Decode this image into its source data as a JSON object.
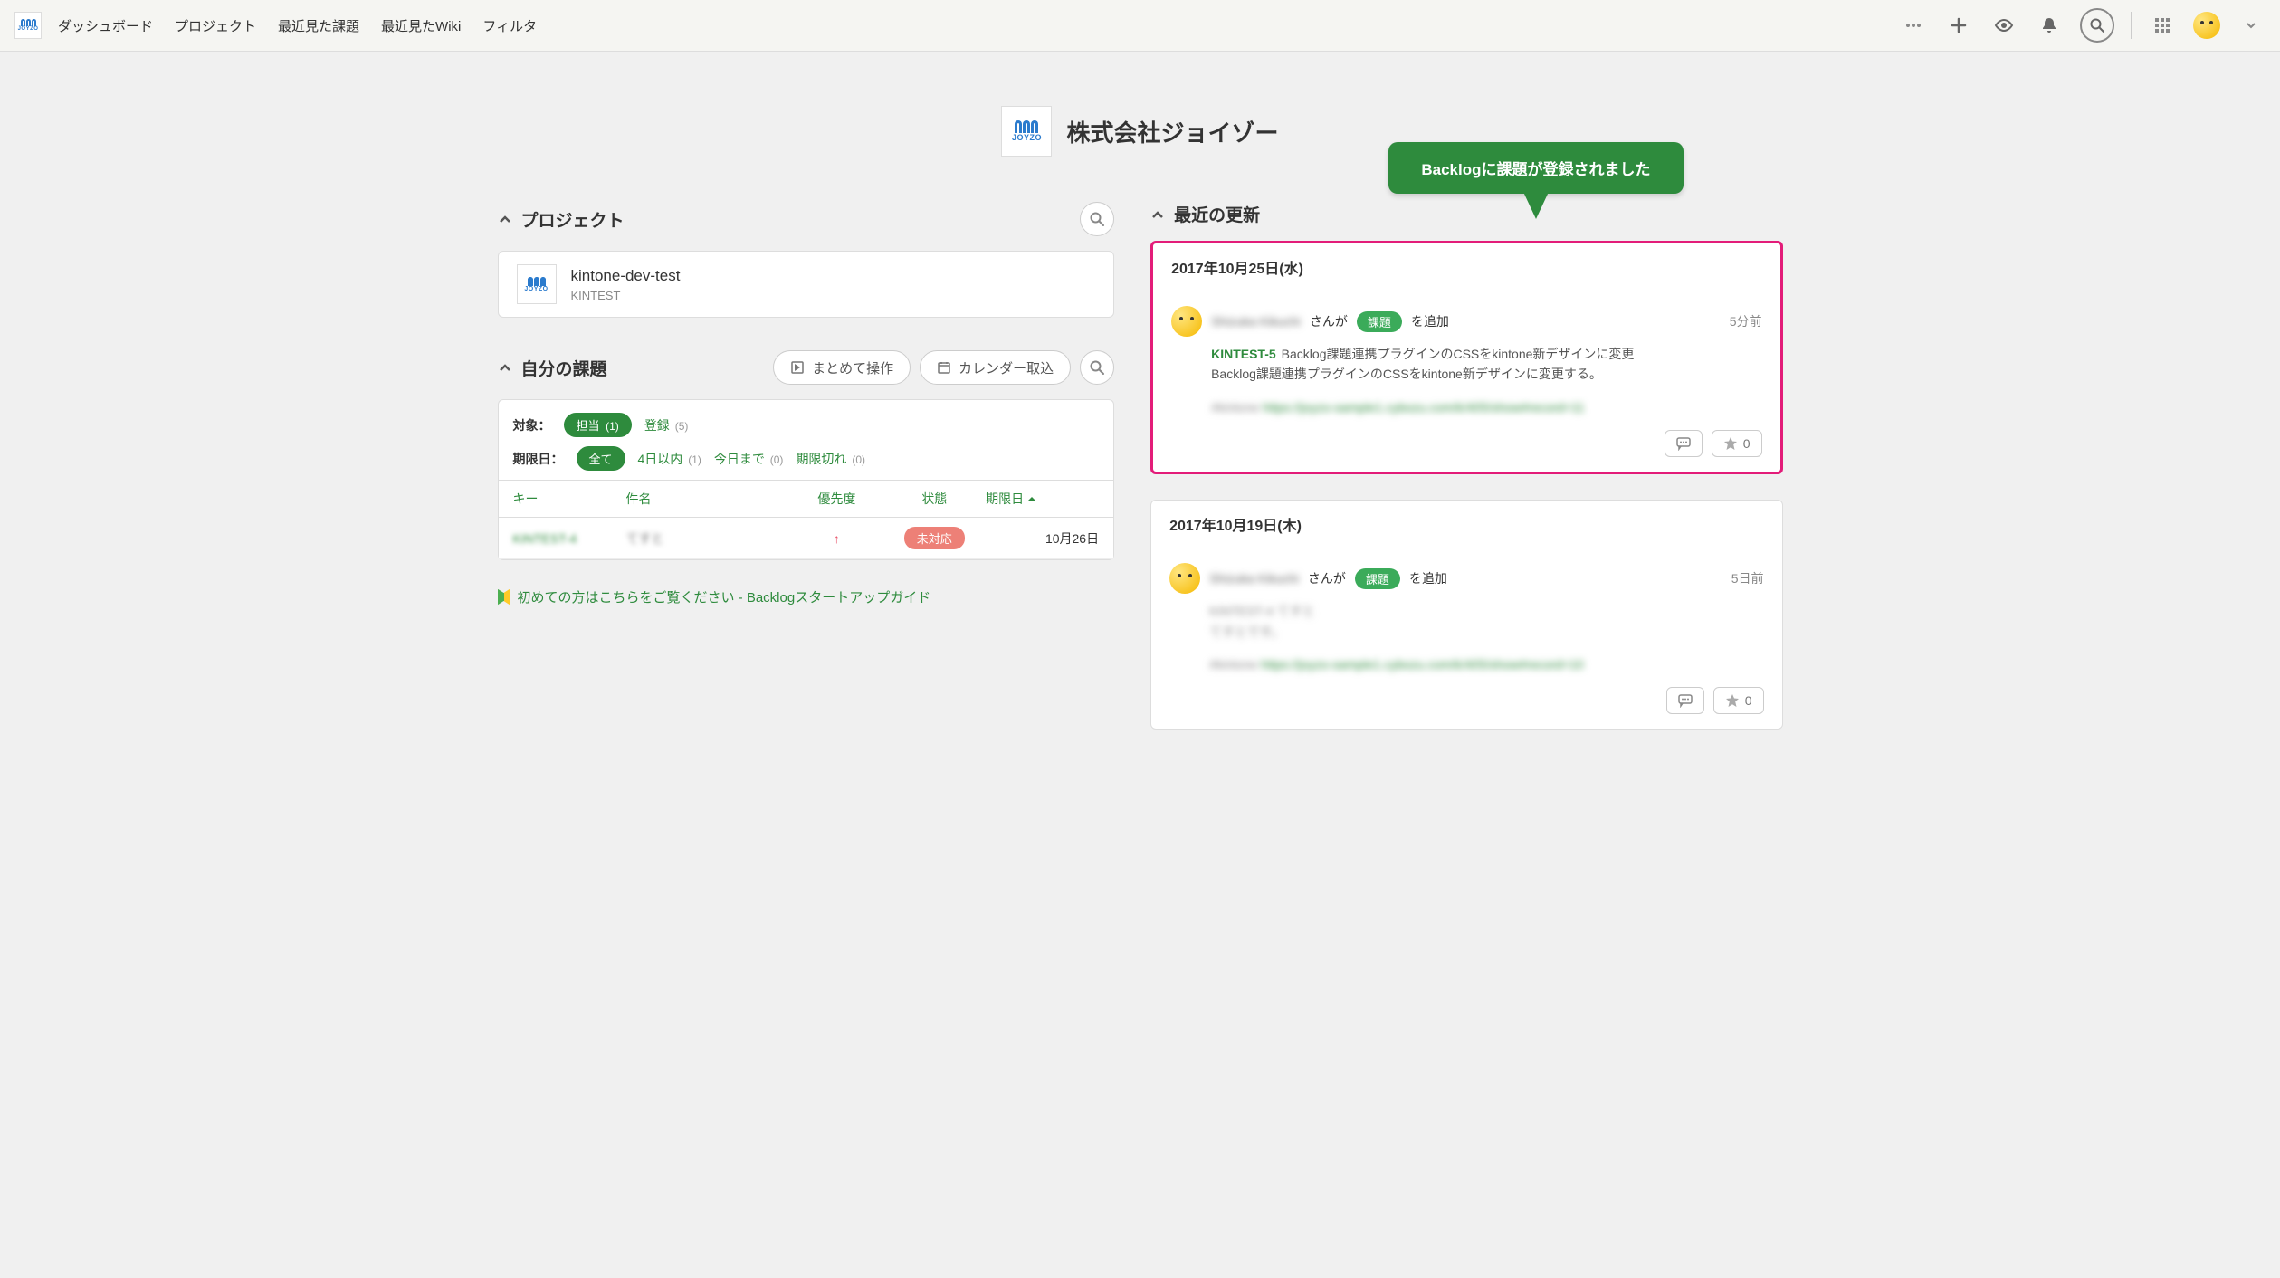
{
  "nav": {
    "items": [
      "ダッシュボード",
      "プロジェクト",
      "最近見た課題",
      "最近見たWiki",
      "フィルタ"
    ]
  },
  "company": {
    "title": "株式会社ジョイゾー",
    "logo_text": "JOYZO"
  },
  "callout": {
    "text": "Backlogに課題が登録されました"
  },
  "sections": {
    "projects": "プロジェクト",
    "my_issues": "自分の課題",
    "recent_updates": "最近の更新"
  },
  "project_card": {
    "name": "kintone-dev-test",
    "key": "KINTEST"
  },
  "buttons": {
    "bulk": "まとめて操作",
    "calendar": "カレンダー取込"
  },
  "filters": {
    "target_label": "対象：",
    "assigned": "担当",
    "assigned_count": "(1)",
    "registered": "登録",
    "registered_count": "(5)",
    "due_label": "期限日：",
    "all": "全て",
    "within4": "4日以内",
    "within4_count": "(1)",
    "today": "今日まで",
    "today_count": "(0)",
    "overdue": "期限切れ",
    "overdue_count": "(0)"
  },
  "table": {
    "headers": {
      "key": "キー",
      "subject": "件名",
      "priority": "優先度",
      "status": "状態",
      "due": "期限日"
    },
    "row": {
      "key": "KINTEST-4",
      "subject": "てすと",
      "status": "未対応",
      "due": "10月26日"
    }
  },
  "guide": {
    "text": "初めての方はこちらをご覧ください - Backlogスタートアップガイド"
  },
  "updates": [
    {
      "date": "2017年10月25日(水)",
      "highlight": true,
      "user": "Shizuka Kikuchi",
      "action_prefix": "さんが",
      "badge": "課題",
      "action_suffix": "を追加",
      "time": "5分前",
      "issue_key": "KINTEST-5",
      "title": "Backlog課題連携プラグインのCSSをkintone新デザインに変更",
      "desc": "Backlog課題連携プラグインのCSSをkintone新デザインに変更する。",
      "meta_label": "#kintone",
      "meta_link": "https://joyzo-sample1.cybozu.com/k/405/show#record=11",
      "star_count": "0"
    },
    {
      "date": "2017年10月19日(木)",
      "highlight": false,
      "user": "Shizuka Kikuchi",
      "action_prefix": "さんが",
      "badge": "課題",
      "action_suffix": "を追加",
      "time": "5日前",
      "issue_key": "KINTEST-4",
      "title": "てすと",
      "desc": "てすとです。",
      "meta_label": "#kintone",
      "meta_link": "https://joyzo-sample1.cybozu.com/k/405/show#record=10",
      "star_count": "0"
    }
  ]
}
